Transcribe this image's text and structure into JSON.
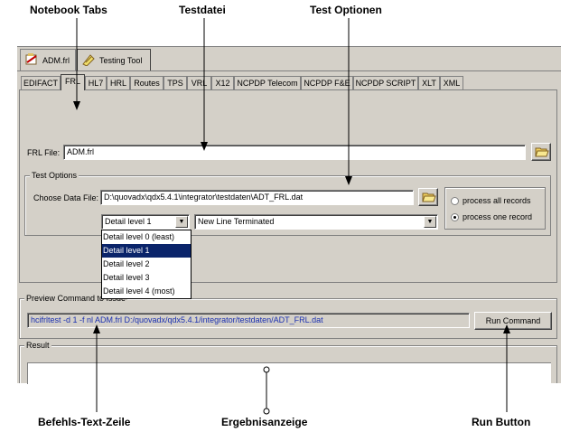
{
  "annotations": {
    "notebook_tabs": "Notebook Tabs",
    "testdatei": "Testdatei",
    "test_optionen": "Test Optionen",
    "befehls_text_zeile": "Befehls-Text-Zeile",
    "ergebnisanzeige": "Ergebnisanzeige",
    "run_button": "Run Button"
  },
  "window_tabs": [
    "ADM.frl",
    "Testing Tool"
  ],
  "notebook_tabs": [
    "EDIFACT",
    "FRL",
    "HL7",
    "HRL",
    "Routes",
    "TPS",
    "VRL",
    "X12",
    "NCPDP Telecom",
    "NCPDP F&E",
    "NCPDP SCRIPT",
    "XLT",
    "XML"
  ],
  "active_tab": "FRL",
  "frl_file": {
    "label": "FRL File:",
    "value": "ADM.frl"
  },
  "test_options": {
    "legend": "Test Options",
    "data_file_label": "Choose Data File:",
    "data_file_value": "D:\\quovadx\\qdx5.4.1\\integrator\\testdaten\\ADT_FRL.dat",
    "detail_selected": "Detail level 1",
    "line_mode": "New Line Terminated",
    "radio_all": "process all records",
    "radio_one": "process one record",
    "radio_selected": "one"
  },
  "detail_options": [
    "Detail level 0 (least)",
    "Detail level 1",
    "Detail level 2",
    "Detail level 3",
    "Detail level 4 (most)"
  ],
  "preview": {
    "legend": "Preview Command to Issue",
    "command": "hcifrltest -d 1 -f nl ADM.frl D:/quovadx/qdx5.4.1/integrator/testdaten/ADT_FRL.dat",
    "run_label": "Run Command"
  },
  "result": {
    "legend": "Result"
  },
  "colors": {
    "panel": "#d4d0c8",
    "command_text": "#1a2fb0",
    "selection": "#0a246a"
  }
}
